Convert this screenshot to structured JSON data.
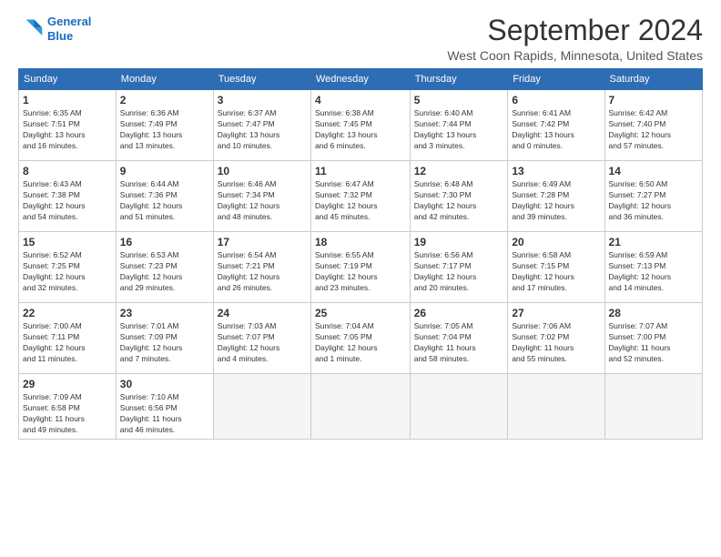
{
  "header": {
    "logo_line1": "General",
    "logo_line2": "Blue",
    "month": "September 2024",
    "location": "West Coon Rapids, Minnesota, United States"
  },
  "days_of_week": [
    "Sunday",
    "Monday",
    "Tuesday",
    "Wednesday",
    "Thursday",
    "Friday",
    "Saturday"
  ],
  "weeks": [
    [
      {
        "day": "1",
        "info": "Sunrise: 6:35 AM\nSunset: 7:51 PM\nDaylight: 13 hours\nand 16 minutes."
      },
      {
        "day": "2",
        "info": "Sunrise: 6:36 AM\nSunset: 7:49 PM\nDaylight: 13 hours\nand 13 minutes."
      },
      {
        "day": "3",
        "info": "Sunrise: 6:37 AM\nSunset: 7:47 PM\nDaylight: 13 hours\nand 10 minutes."
      },
      {
        "day": "4",
        "info": "Sunrise: 6:38 AM\nSunset: 7:45 PM\nDaylight: 13 hours\nand 6 minutes."
      },
      {
        "day": "5",
        "info": "Sunrise: 6:40 AM\nSunset: 7:44 PM\nDaylight: 13 hours\nand 3 minutes."
      },
      {
        "day": "6",
        "info": "Sunrise: 6:41 AM\nSunset: 7:42 PM\nDaylight: 13 hours\nand 0 minutes."
      },
      {
        "day": "7",
        "info": "Sunrise: 6:42 AM\nSunset: 7:40 PM\nDaylight: 12 hours\nand 57 minutes."
      }
    ],
    [
      {
        "day": "8",
        "info": "Sunrise: 6:43 AM\nSunset: 7:38 PM\nDaylight: 12 hours\nand 54 minutes."
      },
      {
        "day": "9",
        "info": "Sunrise: 6:44 AM\nSunset: 7:36 PM\nDaylight: 12 hours\nand 51 minutes."
      },
      {
        "day": "10",
        "info": "Sunrise: 6:46 AM\nSunset: 7:34 PM\nDaylight: 12 hours\nand 48 minutes."
      },
      {
        "day": "11",
        "info": "Sunrise: 6:47 AM\nSunset: 7:32 PM\nDaylight: 12 hours\nand 45 minutes."
      },
      {
        "day": "12",
        "info": "Sunrise: 6:48 AM\nSunset: 7:30 PM\nDaylight: 12 hours\nand 42 minutes."
      },
      {
        "day": "13",
        "info": "Sunrise: 6:49 AM\nSunset: 7:28 PM\nDaylight: 12 hours\nand 39 minutes."
      },
      {
        "day": "14",
        "info": "Sunrise: 6:50 AM\nSunset: 7:27 PM\nDaylight: 12 hours\nand 36 minutes."
      }
    ],
    [
      {
        "day": "15",
        "info": "Sunrise: 6:52 AM\nSunset: 7:25 PM\nDaylight: 12 hours\nand 32 minutes."
      },
      {
        "day": "16",
        "info": "Sunrise: 6:53 AM\nSunset: 7:23 PM\nDaylight: 12 hours\nand 29 minutes."
      },
      {
        "day": "17",
        "info": "Sunrise: 6:54 AM\nSunset: 7:21 PM\nDaylight: 12 hours\nand 26 minutes."
      },
      {
        "day": "18",
        "info": "Sunrise: 6:55 AM\nSunset: 7:19 PM\nDaylight: 12 hours\nand 23 minutes."
      },
      {
        "day": "19",
        "info": "Sunrise: 6:56 AM\nSunset: 7:17 PM\nDaylight: 12 hours\nand 20 minutes."
      },
      {
        "day": "20",
        "info": "Sunrise: 6:58 AM\nSunset: 7:15 PM\nDaylight: 12 hours\nand 17 minutes."
      },
      {
        "day": "21",
        "info": "Sunrise: 6:59 AM\nSunset: 7:13 PM\nDaylight: 12 hours\nand 14 minutes."
      }
    ],
    [
      {
        "day": "22",
        "info": "Sunrise: 7:00 AM\nSunset: 7:11 PM\nDaylight: 12 hours\nand 11 minutes."
      },
      {
        "day": "23",
        "info": "Sunrise: 7:01 AM\nSunset: 7:09 PM\nDaylight: 12 hours\nand 7 minutes."
      },
      {
        "day": "24",
        "info": "Sunrise: 7:03 AM\nSunset: 7:07 PM\nDaylight: 12 hours\nand 4 minutes."
      },
      {
        "day": "25",
        "info": "Sunrise: 7:04 AM\nSunset: 7:05 PM\nDaylight: 12 hours\nand 1 minute."
      },
      {
        "day": "26",
        "info": "Sunrise: 7:05 AM\nSunset: 7:04 PM\nDaylight: 11 hours\nand 58 minutes."
      },
      {
        "day": "27",
        "info": "Sunrise: 7:06 AM\nSunset: 7:02 PM\nDaylight: 11 hours\nand 55 minutes."
      },
      {
        "day": "28",
        "info": "Sunrise: 7:07 AM\nSunset: 7:00 PM\nDaylight: 11 hours\nand 52 minutes."
      }
    ],
    [
      {
        "day": "29",
        "info": "Sunrise: 7:09 AM\nSunset: 6:58 PM\nDaylight: 11 hours\nand 49 minutes."
      },
      {
        "day": "30",
        "info": "Sunrise: 7:10 AM\nSunset: 6:56 PM\nDaylight: 11 hours\nand 46 minutes."
      },
      {
        "day": "",
        "info": ""
      },
      {
        "day": "",
        "info": ""
      },
      {
        "day": "",
        "info": ""
      },
      {
        "day": "",
        "info": ""
      },
      {
        "day": "",
        "info": ""
      }
    ]
  ]
}
